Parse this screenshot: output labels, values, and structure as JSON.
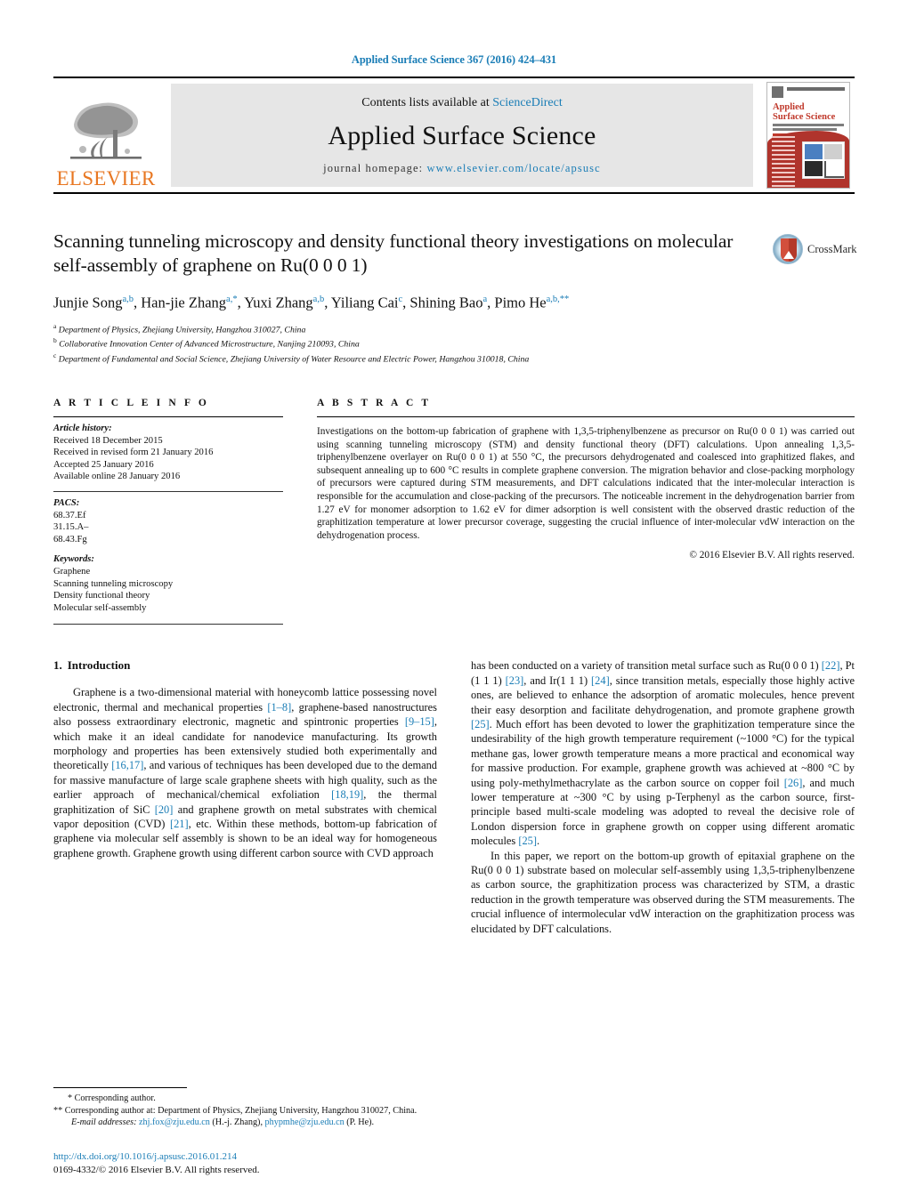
{
  "running_head": "Applied Surface Science 367 (2016) 424–431",
  "masthead": {
    "publisher_logo_text": "ELSEVIER",
    "contents_prefix": "Contents lists available at ",
    "contents_link": "ScienceDirect",
    "journal_name": "Applied Surface Science",
    "homepage_prefix": "journal homepage: ",
    "homepage_url": "www.elsevier.com/locate/apsusc",
    "cover_title_line1": "Applied",
    "cover_title_line2": "Surface Science"
  },
  "title": "Scanning tunneling microscopy and density functional theory investigations on molecular self-assembly of graphene on Ru(0 0 0 1)",
  "crossmark_label": "CrossMark",
  "authors_html": "Junjie Song<sup>a,b</sup>, Han-jie Zhang<sup>a,*</sup>, Yuxi Zhang<sup>a,b</sup>, Yiliang Cai<sup>c</sup>, Shining Bao<sup>a</sup>, Pimo He<sup>a,b,**</sup>",
  "affiliations": [
    {
      "marker": "a",
      "text": "Department of Physics, Zhejiang University, Hangzhou 310027, China"
    },
    {
      "marker": "b",
      "text": "Collaborative Innovation Center of Advanced Microstructure, Nanjing 210093, China"
    },
    {
      "marker": "c",
      "text": "Department of Fundamental and Social Science, Zhejiang University of Water Resource and Electric Power, Hangzhou 310018, China"
    }
  ],
  "article_info": {
    "heading": "A R T I C L E    I N F O",
    "history_label": "Article history:",
    "history": [
      "Received 18 December 2015",
      "Received in revised form 21 January 2016",
      "Accepted 25 January 2016",
      "Available online 28 January 2016"
    ],
    "pacs_label": "PACS:",
    "pacs": [
      "68.37.Ef",
      "31.15.A–",
      "68.43.Fg"
    ],
    "keywords_label": "Keywords:",
    "keywords": [
      "Graphene",
      "Scanning tunneling microscopy",
      "Density functional theory",
      "Molecular self-assembly"
    ]
  },
  "abstract": {
    "heading": "A B S T R A C T",
    "text": "Investigations on the bottom-up fabrication of graphene with 1,3,5-triphenylbenzene as precursor on Ru(0 0 0 1) was carried out using scanning tunneling microscopy (STM) and density functional theory (DFT) calculations. Upon annealing 1,3,5-triphenylbenzene overlayer on Ru(0 0 0 1) at 550 °C, the precursors dehydrogenated and coalesced into graphitized flakes, and subsequent annealing up to 600 °C results in complete graphene conversion. The migration behavior and close-packing morphology of precursors were captured during STM measurements, and DFT calculations indicated that the inter-molecular interaction is responsible for the accumulation and close-packing of the precursors. The noticeable increment in the dehydrogenation barrier from 1.27 eV for monomer adsorption to 1.62 eV for dimer adsorption is well consistent with the observed drastic reduction of the graphitization temperature at lower precursor coverage, suggesting the crucial influence of inter-molecular vdW interaction on the dehydrogenation process.",
    "copyright": "© 2016 Elsevier B.V. All rights reserved."
  },
  "introduction": {
    "number": "1.",
    "heading": "Introduction",
    "paragraph1_html": "Graphene is a two-dimensional material with honeycomb lattice possessing novel electronic, thermal and mechanical properties <span class=\"ref\">[1–8]</span>, graphene-based nanostructures also possess extraordinary electronic, magnetic and spintronic properties <span class=\"ref\">[9–15]</span>, which make it an ideal candidate for nanodevice manufacturing. Its growth morphology and properties has been extensively studied both experimentally and theoretically <span class=\"ref\">[16,17]</span>, and various of techniques has been developed due to the demand for massive manufacture of large scale graphene sheets with high quality, such as the earlier approach of mechanical/chemical exfoliation <span class=\"ref\">[18,19]</span>, the thermal graphitization of SiC <span class=\"ref\">[20]</span> and graphene growth on metal substrates with chemical vapor deposition (CVD) <span class=\"ref\">[21]</span>, etc. Within these methods, bottom-up fabrication of graphene via molecular self assembly is shown to be an ideal way for homogeneous graphene growth. Graphene growth using different carbon source with CVD approach has been conducted on a variety of transition metal surface such as Ru(0 0 0 1) <span class=\"ref\">[22]</span>, Pt (1 1 1) <span class=\"ref\">[23]</span>, and Ir(1 1 1) <span class=\"ref\">[24]</span>, since transition metals, especially those highly active ones, are believed to enhance the adsorption of aromatic molecules, hence prevent their easy desorption and facilitate dehydrogenation, and promote graphene growth <span class=\"ref\">[25]</span>. Much effort has been devoted to lower the graphitization temperature since the undesirability of the high growth temperature requirement (~1000 °C) for the typical methane gas, lower growth temperature means a more practical and economical way for massive production. For example, graphene growth was achieved at ~800 °C by using poly-methylmethacrylate as the carbon source on copper foil <span class=\"ref\">[26]</span>, and much lower temperature at ~300 °C by using p-Terphenyl as the carbon source, first-principle based multi-scale modeling was adopted to reveal the decisive role of London dispersion force in graphene growth on copper using different aromatic molecules <span class=\"ref\">[25]</span>.",
    "paragraph2_html": "In this paper, we report on the bottom-up growth of epitaxial graphene on the Ru(0 0 0 1) substrate based on molecular self-assembly using 1,3,5-triphenylbenzene as carbon source, the graphitization process was characterized by STM, a drastic reduction in the growth temperature was observed during the STM measurements. The crucial influence of intermolecular vdW interaction on the graphitization process was elucidated by DFT calculations."
  },
  "footnotes": {
    "corresponding1": "* Corresponding author.",
    "corresponding2": "** Corresponding author at: Department of Physics, Zhejiang University, Hangzhou 310027, China.",
    "email_label": "E-mail addresses:",
    "email1": "zhj.fox@zju.edu.cn",
    "email1_owner": "(H.-j. Zhang),",
    "email2": "phypmhe@zju.edu.cn",
    "email2_owner": "(P. He)."
  },
  "bottom": {
    "doi": "http://dx.doi.org/10.1016/j.apsusc.2016.01.214",
    "issn": "0169-4332/© 2016 Elsevier B.V. All rights reserved."
  }
}
